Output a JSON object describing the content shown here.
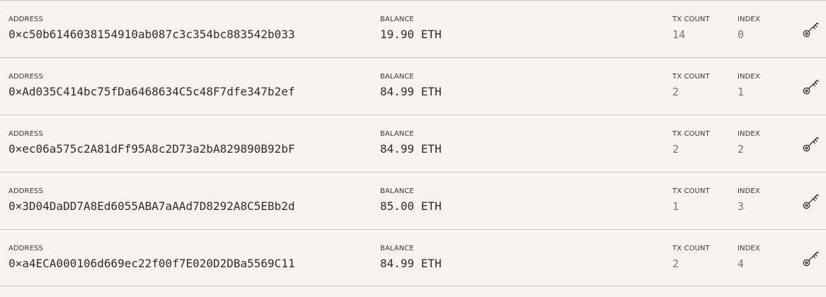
{
  "accounts": [
    {
      "address_label": "ADDRESS",
      "address": "0×c50b6146038154910ab087c3c354bc883542b033",
      "balance_label": "BALANCE",
      "balance": "19.90 ETH",
      "tx_count_label": "TX COUNT",
      "tx_count": "14",
      "index_label": "INDEX",
      "index": "0",
      "action_icon": "key-icon"
    },
    {
      "address_label": "ADDRESS",
      "address": "0×Ad035C414bc75fDa6468634C5c48F7dfe347b2ef",
      "balance_label": "BALANCE",
      "balance": "84.99 ETH",
      "tx_count_label": "TX COUNT",
      "tx_count": "2",
      "index_label": "INDEX",
      "index": "1",
      "action_icon": "key-icon"
    },
    {
      "address_label": "ADDRESS",
      "address": "0×ec06a575c2A81dFf95A8c2D73a2bA829890B92bF",
      "balance_label": "BALANCE",
      "balance": "84.99 ETH",
      "tx_count_label": "TX COUNT",
      "tx_count": "2",
      "index_label": "INDEX",
      "index": "2",
      "action_icon": "key-icon"
    },
    {
      "address_label": "ADDRESS",
      "address": "0×3D04DaDD7A8Ed6055ABA7aAAd7D8292A8C5EBb2d",
      "balance_label": "BALANCE",
      "balance": "85.00 ETH",
      "tx_count_label": "TX COUNT",
      "tx_count": "1",
      "index_label": "INDEX",
      "index": "3",
      "action_icon": "key-icon"
    },
    {
      "address_label": "ADDRESS",
      "address": "0×a4ECA000106d669ec22f00f7E020D2DBa5569C11",
      "balance_label": "BALANCE",
      "balance": "84.99 ETH",
      "tx_count_label": "TX COUNT",
      "tx_count": "2",
      "index_label": "INDEX",
      "index": "4",
      "action_icon": "key-icon"
    }
  ],
  "colors": {
    "background": "#f5f4ee",
    "divider": "#c8c6bd",
    "text_primary": "#2e2e2b",
    "text_secondary": "#77766f"
  }
}
